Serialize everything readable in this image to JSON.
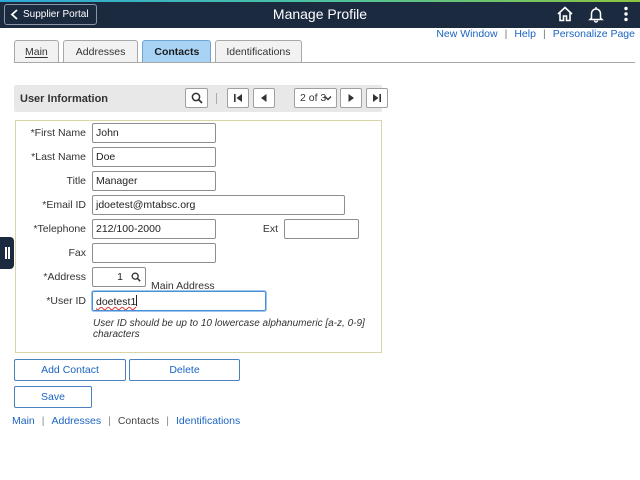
{
  "header": {
    "back_label": "Supplier Portal",
    "title": "Manage Profile",
    "icons": [
      "home-icon",
      "bell-icon",
      "kebab-menu-icon"
    ]
  },
  "page_links": [
    {
      "label": "New Window"
    },
    {
      "label": "Help"
    },
    {
      "label": "Personalize Page"
    }
  ],
  "tabs": [
    {
      "label": "Main",
      "active": false
    },
    {
      "label": "Addresses",
      "active": false
    },
    {
      "label": "Contacts",
      "active": true
    },
    {
      "label": "Identifications",
      "active": false
    }
  ],
  "group": {
    "title": "User Information",
    "page_selector": "2 of 3"
  },
  "form": {
    "first_name": {
      "label": "*First Name",
      "value": "John"
    },
    "last_name": {
      "label": "*Last Name",
      "value": "Doe"
    },
    "title": {
      "label": "Title",
      "value": "Manager"
    },
    "email": {
      "label": "*Email ID",
      "value": "jdoetest@mtabsc.org"
    },
    "telephone": {
      "label": "*Telephone",
      "value": "212/100-2000"
    },
    "ext": {
      "label": "Ext",
      "value": ""
    },
    "fax": {
      "label": "Fax",
      "value": ""
    },
    "address": {
      "label": "*Address",
      "value": "1",
      "description": "Main Address"
    },
    "user_id": {
      "label": "*User ID",
      "value": "doetest1"
    },
    "hint": "User ID should be up to 10 lowercase alphanumeric [a-z, 0-9] characters"
  },
  "buttons": {
    "add_contact": "Add Contact",
    "delete": "Delete",
    "save": "Save"
  },
  "bottom_links": [
    {
      "label": "Main",
      "current": false
    },
    {
      "label": "Addresses",
      "current": false
    },
    {
      "label": "Contacts",
      "current": true
    },
    {
      "label": "Identifications",
      "current": false
    }
  ],
  "colors": {
    "header_bg": "#1c2a3f",
    "active_tab": "#a9d3f5",
    "link": "#1b64c2"
  }
}
